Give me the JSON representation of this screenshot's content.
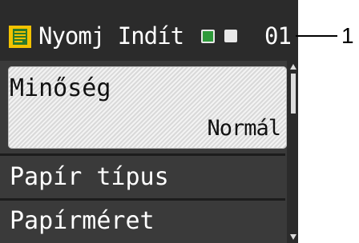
{
  "status": {
    "icon": "document-icon",
    "title": "Nyomj Indít",
    "indicators": [
      {
        "name": "green-indicator",
        "color": "#2e9a3a"
      },
      {
        "name": "white-indicator",
        "color": "#e8e8e8"
      }
    ],
    "counter": "01"
  },
  "menu": {
    "items": [
      {
        "label": "Minőség",
        "value": "Normál",
        "selected": true
      },
      {
        "label": "Papír típus"
      },
      {
        "label": "Papírméret"
      }
    ]
  },
  "callout": {
    "number": "1"
  },
  "colors": {
    "lcd_background": "#3a3a3a",
    "status_background": "#2b2b2b",
    "selection": "#e8e8e8",
    "text": "#ffffff"
  }
}
